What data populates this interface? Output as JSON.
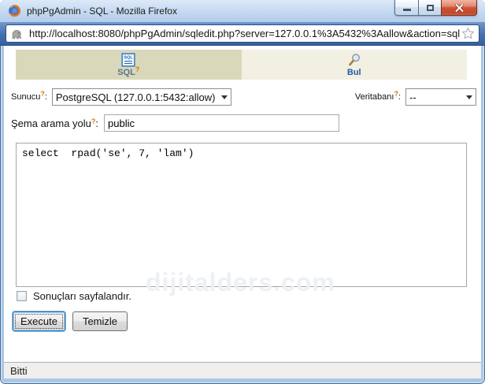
{
  "window": {
    "title": "phpPgAdmin - SQL - Mozilla Firefox"
  },
  "browser": {
    "url": "http://localhost:8080/phpPgAdmin/sqledit.php?server=127.0.0.1%3A5432%3Aallow&action=sql"
  },
  "punctuation": {
    "colon": ":"
  },
  "tabs": [
    {
      "label": "SQL",
      "icon_text": "SQL",
      "help_marker": "?"
    },
    {
      "label": "Bul"
    }
  ],
  "form": {
    "server": {
      "label": "Sunucu",
      "help_marker": "?",
      "value": "PostgreSQL (127.0.0.1:5432:allow)"
    },
    "database": {
      "label": "Veritabanı",
      "help_marker": "?",
      "value": "--"
    },
    "schema": {
      "label": "Şema arama yolu",
      "help_marker": "?",
      "value": "public"
    },
    "sql_text": "select  rpad('se', 7, 'lam')",
    "paginate_label": "Sonuçları sayfalandır.",
    "buttons": {
      "execute": "Execute",
      "clear": "Temizle"
    }
  },
  "watermark": "dijitalders.com",
  "status": {
    "text": "Bitti"
  },
  "colors": {
    "tab_active_bg": "#d9d8ba",
    "tab_inactive_bg": "#f1f0e2",
    "help_orange": "#d4770c",
    "chrome_blue": "#3a66a4",
    "close_red": "#cf5233",
    "frame_blue": "#a9c7e8"
  }
}
